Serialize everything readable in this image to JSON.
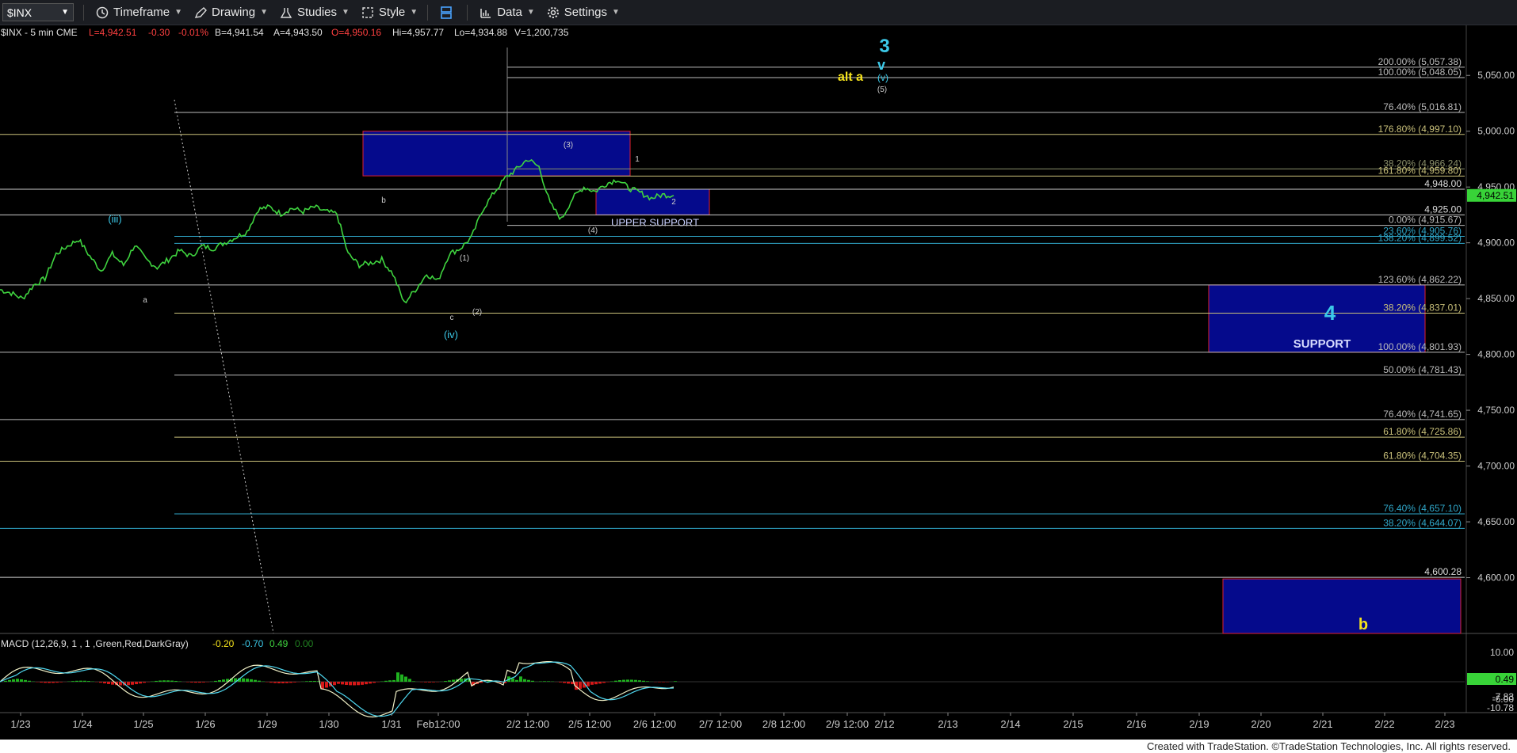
{
  "toolbar": {
    "symbol": "$INX",
    "items": [
      {
        "label": "Timeframe",
        "icon": "clock-icon"
      },
      {
        "label": "Drawing",
        "icon": "pencil-icon"
      },
      {
        "label": "Studies",
        "icon": "flask-icon"
      },
      {
        "label": "Style",
        "icon": "style-icon"
      },
      {
        "label": "",
        "icon": "layout-icon"
      },
      {
        "label": "Data",
        "icon": "bar-chart-icon"
      },
      {
        "label": "Settings",
        "icon": "gear-icon"
      }
    ]
  },
  "info_bar": {
    "symbol_info": "$INX - 5 min  CME",
    "last": "L=4,942.51",
    "change": "-0.30",
    "pct": "-0.01%",
    "bid": "B=4,941.54",
    "ask": "A=4,943.50",
    "open": "O=4,950.16",
    "high": "Hi=4,957.77",
    "low": "Lo=4,934.88",
    "volume": "V=1,200,735"
  },
  "macd_bar": {
    "label": "MACD (12,26,9, 1 , 1 ,Green,Red,DarkGray)",
    "v1": "-0.20",
    "v2": "-0.70",
    "v3": "0.49",
    "v4": "0.00"
  },
  "footer": "Created with TradeStation. ©TradeStation Technologies, Inc. All rights reserved.",
  "colors": {
    "price": "#3fd43f",
    "axis": "#cccccc",
    "zone": "#050a8c",
    "zone_border": "#e02030",
    "cyan": "#3cc9e8",
    "yellow": "#f5e31c"
  },
  "chart_data": {
    "type": "line",
    "ylim": [
      4550,
      5075
    ],
    "price_axis_labels": [
      "5,050.00",
      "5,000.00",
      "4,950.00",
      "4,900.00",
      "4,850.00",
      "4,800.00",
      "4,750.00",
      "4,700.00",
      "4,650.00",
      "4,600.00"
    ],
    "price_axis_values": [
      5050,
      5000,
      4950,
      4900,
      4850,
      4800,
      4750,
      4700,
      4650,
      4600
    ],
    "last_price_tag": "4,942.51",
    "x_tick_labels": [
      "1/23",
      "1/24",
      "1/25",
      "1/26",
      "1/29",
      "1/30",
      "1/31",
      "Feb12:00",
      "2/2 12:00",
      "2/5 12:00",
      "2/6 12:00",
      "2/7 12:00",
      "2/8 12:00",
      "2/9 12:00",
      "2/12",
      "2/13",
      "2/14",
      "2/15",
      "2/16",
      "2/19",
      "2/20",
      "2/21",
      "2/22",
      "2/23"
    ],
    "series": [
      {
        "values": [
          4858,
          4855,
          4850,
          4862,
          4868,
          4890,
          4897,
          4903,
          4888,
          4875,
          4890,
          4880,
          4898,
          4885,
          4878,
          4885,
          4893,
          4888,
          4897,
          4895,
          4900,
          4905,
          4910,
          4930,
          4932,
          4926,
          4931,
          4928,
          4932,
          4928,
          4926,
          4890,
          4880,
          4882,
          4885,
          4872,
          4846,
          4858,
          4872,
          4866,
          4890,
          4895,
          4905,
          4930,
          4945,
          4958,
          4966,
          4975,
          4968,
          4935,
          4921,
          4940,
          4950,
          4946,
          4953,
          4957,
          4949,
          4945,
          4940,
          4943,
          4942.5
        ]
      }
    ],
    "fib_levels": [
      {
        "label": "200.00% (5,057.38)",
        "value": 5057.38,
        "color": "#bbbbbb"
      },
      {
        "label": "100.00% (5,048.05)",
        "value": 5048.05,
        "color": "#bbbbbb"
      },
      {
        "label": "76.40% (5,016.81)",
        "value": 5016.81,
        "color": "#bbbbbb"
      },
      {
        "label": "176.80% (4,997.10)",
        "value": 4997.1,
        "color": "#c9c07a"
      },
      {
        "label": "38.20% (4,966.24)",
        "value": 4966.24,
        "color": "#8a8f6a"
      },
      {
        "label": "161.80% (4,959.80)",
        "value": 4959.8,
        "color": "#c9c07a"
      },
      {
        "label": "0.00% (4,915.67)",
        "value": 4915.67,
        "color": "#bbbbbb"
      },
      {
        "label": "23.60% (4,905.76)",
        "value": 4905.76,
        "color": "#2fa6c8"
      },
      {
        "label": "138.20% (4,899.52)",
        "value": 4899.52,
        "color": "#2fa6c8"
      },
      {
        "label": "123.60% (4,862.22)",
        "value": 4862.22,
        "color": "#bbbbbb"
      },
      {
        "label": "38.20% (4,837.01)",
        "value": 4837.01,
        "color": "#c9c07a"
      },
      {
        "label": "100.00% (4,801.93)",
        "value": 4801.93,
        "color": "#bbbbbb"
      },
      {
        "label": "50.00% (4,781.43)",
        "value": 4781.43,
        "color": "#bbbbbb"
      },
      {
        "label": "76.40% (4,741.65)",
        "value": 4741.65,
        "color": "#bbbbbb"
      },
      {
        "label": "61.80% (4,725.86)",
        "value": 4725.86,
        "color": "#c9c07a"
      },
      {
        "label": "61.80% (4,704.35)",
        "value": 4704.35,
        "color": "#c9c07a"
      },
      {
        "label": "76.40% (4,657.10)",
        "value": 4657.1,
        "color": "#2fa6c8"
      },
      {
        "label": "38.20% (4,644.07)",
        "value": 4644.07,
        "color": "#2fa6c8"
      }
    ],
    "horizontal_levels": [
      {
        "label": "4,948.00",
        "value": 4948
      },
      {
        "label": "4,925.00",
        "value": 4925
      },
      {
        "label": "4,600.28",
        "value": 4600.28
      }
    ],
    "zones": [
      {
        "label": "UPPER SUPPORT",
        "top": 4948,
        "bottom": 4925
      },
      {
        "label": "SUPPORT",
        "top": 4862.22,
        "bottom": 4801.93
      },
      {
        "label": "",
        "top": 5000,
        "bottom": 4960
      }
    ],
    "wave_labels": [
      "3",
      "v",
      "(v)",
      "(5)",
      "alt a",
      "(iii)",
      "a",
      "b",
      "c",
      "(iv)",
      "(1)",
      "(2)",
      "(3)",
      "(4)",
      "1",
      "2",
      "4",
      "b"
    ],
    "macd_axis_labels": [
      "10.00",
      "0.00",
      "0.49",
      "-6.00",
      "-7.83",
      "-10.78"
    ]
  }
}
